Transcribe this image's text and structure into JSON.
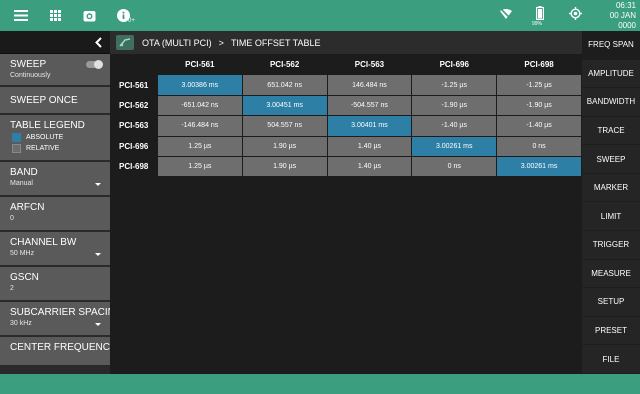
{
  "status": {
    "time": "06:31",
    "date": "00 JAN 0000",
    "battery_percent": "99%",
    "badge": "0+"
  },
  "top_icons": [
    "menu-icon",
    "grid-icon",
    "camera-icon",
    "info-icon"
  ],
  "left": {
    "sweep_title": "SWEEP",
    "sweep_sub": "Continuously",
    "sweep_once": "SWEEP ONCE",
    "legend_title": "TABLE LEGEND",
    "legend_absolute": "ABSOLUTE",
    "legend_relative": "RELATIVE",
    "band_title": "BAND",
    "band_value": "Manual",
    "arfcn_title": "ARFCN",
    "arfcn_value": "0",
    "chbw_title": "CHANNEL BW",
    "chbw_value": "50 MHz",
    "gscn_title": "GSCN",
    "gscn_value": "2",
    "scs_title": "SUBCARRIER SPACING",
    "scs_value": "30 kHz",
    "cf_title": "CENTER FREQUENCY"
  },
  "breadcrumb": {
    "part1": "OTA (MULTI PCI)",
    "sep": ">",
    "part2": "TIME OFFSET TABLE"
  },
  "table": {
    "columns": [
      "PCI-561",
      "PCI-562",
      "PCI-563",
      "PCI-696",
      "PCI-698"
    ],
    "rows": [
      {
        "label": "PCI-561",
        "cells": [
          "3.00386 ms",
          "651.042 ns",
          "146.484 ns",
          "-1.25 µs",
          "-1.25 µs"
        ]
      },
      {
        "label": "PCI-562",
        "cells": [
          "-651.042 ns",
          "3.00451 ms",
          "-504.557 ns",
          "-1.90 µs",
          "-1.90 µs"
        ]
      },
      {
        "label": "PCI-563",
        "cells": [
          "-146.484 ns",
          "504.557 ns",
          "3.00401 ms",
          "-1.40 µs",
          "-1.40 µs"
        ]
      },
      {
        "label": "PCI-696",
        "cells": [
          "1.25 µs",
          "1.90 µs",
          "1.40 µs",
          "3.00261 ms",
          "0 ns"
        ]
      },
      {
        "label": "PCI-698",
        "cells": [
          "1.25 µs",
          "1.90 µs",
          "1.40 µs",
          "0 ns",
          "3.00261 ms"
        ]
      }
    ]
  },
  "right_menu": [
    "FREQ SPAN",
    "AMPLITUDE",
    "BANDWIDTH",
    "TRACE",
    "SWEEP",
    "MARKER",
    "LIMIT",
    "TRIGGER",
    "MEASURE",
    "SETUP",
    "PRESET",
    "FILE"
  ],
  "colors": {
    "accent": "#3a9e7f",
    "absolute": "#2e7fa6",
    "relative": "#6e6e6e"
  }
}
